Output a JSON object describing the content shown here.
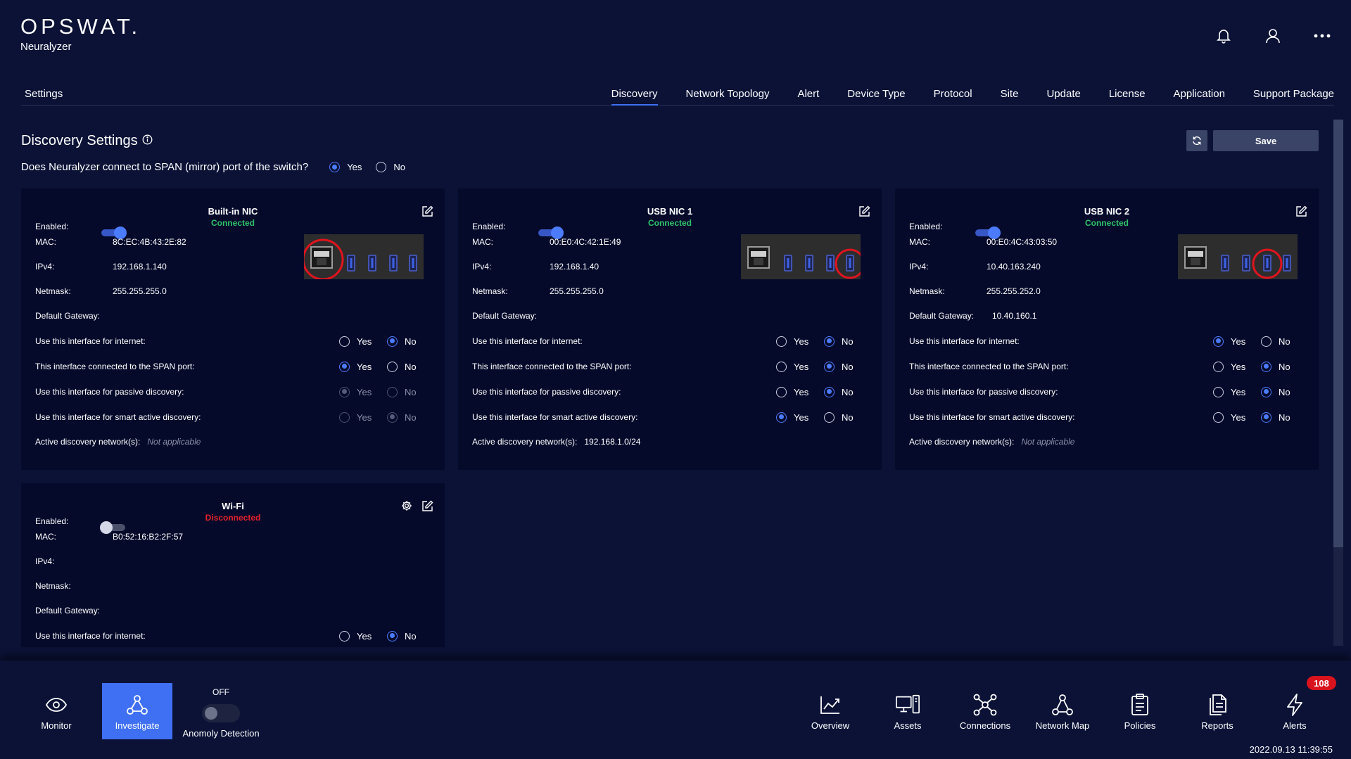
{
  "brand": {
    "logo": "OPSWAT.",
    "product": "Neuralyzer"
  },
  "header_icons": [
    "bell-icon",
    "user-icon",
    "more-icon"
  ],
  "settings_title": "Settings",
  "tabs": [
    {
      "label": "Discovery",
      "active": true
    },
    {
      "label": "Network Topology"
    },
    {
      "label": "Alert"
    },
    {
      "label": "Device Type"
    },
    {
      "label": "Protocol"
    },
    {
      "label": "Site"
    },
    {
      "label": "Update"
    },
    {
      "label": "License"
    },
    {
      "label": "Application"
    },
    {
      "label": "Support Package"
    }
  ],
  "discovery": {
    "title": "Discovery Settings",
    "save_label": "Save",
    "span_question": "Does Neuralyzer connect to SPAN (mirror) port of the switch?",
    "span_answer": "Yes",
    "yes": "Yes",
    "no": "No"
  },
  "labels": {
    "enabled": "Enabled:",
    "mac": "MAC:",
    "ipv4": "IPv4:",
    "netmask": "Netmask:",
    "gateway": "Default Gateway:",
    "q_internet": "Use this interface for internet:",
    "q_span": "This interface connected to the SPAN port:",
    "q_passive": "Use this interface for passive discovery:",
    "q_smart": "Use this interface for smart active discovery:",
    "active_networks": "Active discovery network(s):"
  },
  "cards": [
    {
      "title": "Built-in NIC",
      "status": "Connected",
      "status_color": "#2ec36a",
      "enabled": true,
      "mac": "8C:EC:4B:43:2E:82",
      "ipv4": "192.168.1.140",
      "netmask": "255.255.255.0",
      "gateway": "",
      "internet": "No",
      "span": "Yes",
      "passive": "Yes",
      "passive_disabled": true,
      "smart": "No",
      "smart_disabled": true,
      "active_networks": "",
      "active_networks_na": "Not applicable",
      "highlight_port": 0
    },
    {
      "title": "USB NIC 1",
      "status": "Connected",
      "status_color": "#2ec36a",
      "enabled": true,
      "mac": "00:E0:4C:42:1E:49",
      "ipv4": "192.168.1.40",
      "netmask": "255.255.255.0",
      "gateway": "",
      "internet": "No",
      "span": "No",
      "passive": "No",
      "smart": "Yes",
      "active_networks": "192.168.1.0/24",
      "active_networks_na": "",
      "highlight_port": 4
    },
    {
      "title": "USB NIC 2",
      "status": "Connected",
      "status_color": "#2ec36a",
      "enabled": true,
      "mac": "00:E0:4C:43:03:50",
      "ipv4": "10.40.163.240",
      "netmask": "255.255.252.0",
      "gateway": "10.40.160.1",
      "internet": "Yes",
      "span": "No",
      "passive": "No",
      "smart": "No",
      "active_networks": "",
      "active_networks_na": "Not applicable",
      "highlight_port": 3
    },
    {
      "title": "Wi-Fi",
      "status": "Disconnected",
      "status_color": "#e3212b",
      "enabled": false,
      "mac": "B0:52:16:B2:2F:57",
      "ipv4": "",
      "netmask": "",
      "gateway": "",
      "internet": "No"
    }
  ],
  "bottom_nav": {
    "monitor": "Monitor",
    "investigate": "Investigate",
    "anomaly_state": "OFF",
    "anomaly": "Anomoly Detection",
    "overview": "Overview",
    "assets": "Assets",
    "connections": "Connections",
    "network_map": "Network Map",
    "policies": "Policies",
    "reports": "Reports",
    "alerts": "Alerts",
    "alerts_count": "108"
  },
  "timestamp": "2022.09.13 11:39:55",
  "colors": {
    "background": "#0b1236",
    "card": "#050a2a",
    "accent": "#3f6ff2",
    "connected": "#2ec36a",
    "disconnected": "#e3212b"
  }
}
